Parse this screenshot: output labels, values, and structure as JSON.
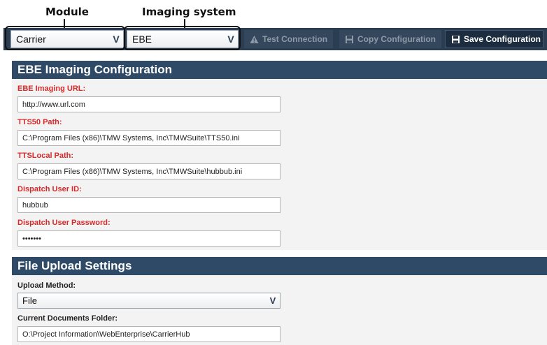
{
  "annotations": {
    "module_label": "Module",
    "imaging_label": "Imaging system"
  },
  "toolbar": {
    "module_value": "Carrier",
    "imaging_value": "EBE",
    "dropdown_caret": "V",
    "test_connection": "Test Connection",
    "copy_configuration": "Copy Configuration",
    "save_configuration": "Save Configuration"
  },
  "ebe_section": {
    "title": "EBE Imaging Configuration",
    "fields": [
      {
        "label": "EBE Imaging URL:",
        "value": "http://www.url.com"
      },
      {
        "label": "TTS50 Path:",
        "value": "C:\\Program Files (x86)\\TMW Systems, Inc\\TMWSuite\\TTS50.ini"
      },
      {
        "label": "TTSLocal Path:",
        "value": "C:\\Program Files (x86)\\TMW Systems, Inc\\TMWSuite\\hubbub.ini"
      },
      {
        "label": "Dispatch User ID:",
        "value": "hubbub"
      },
      {
        "label": "Dispatch User Password:",
        "value": "•••••••"
      }
    ]
  },
  "upload_section": {
    "title": "File Upload Settings",
    "upload_method_label": "Upload Method:",
    "upload_method_value": "File",
    "documents_folder_label": "Current Documents Folder:",
    "documents_folder_value": "O:\\Project Information\\WebEnterprise\\CarrierHub"
  },
  "colors": {
    "toolbar_bg": "#2b3d52",
    "section_header_bg": "#2e4a66",
    "required_label": "#d42a2a"
  }
}
